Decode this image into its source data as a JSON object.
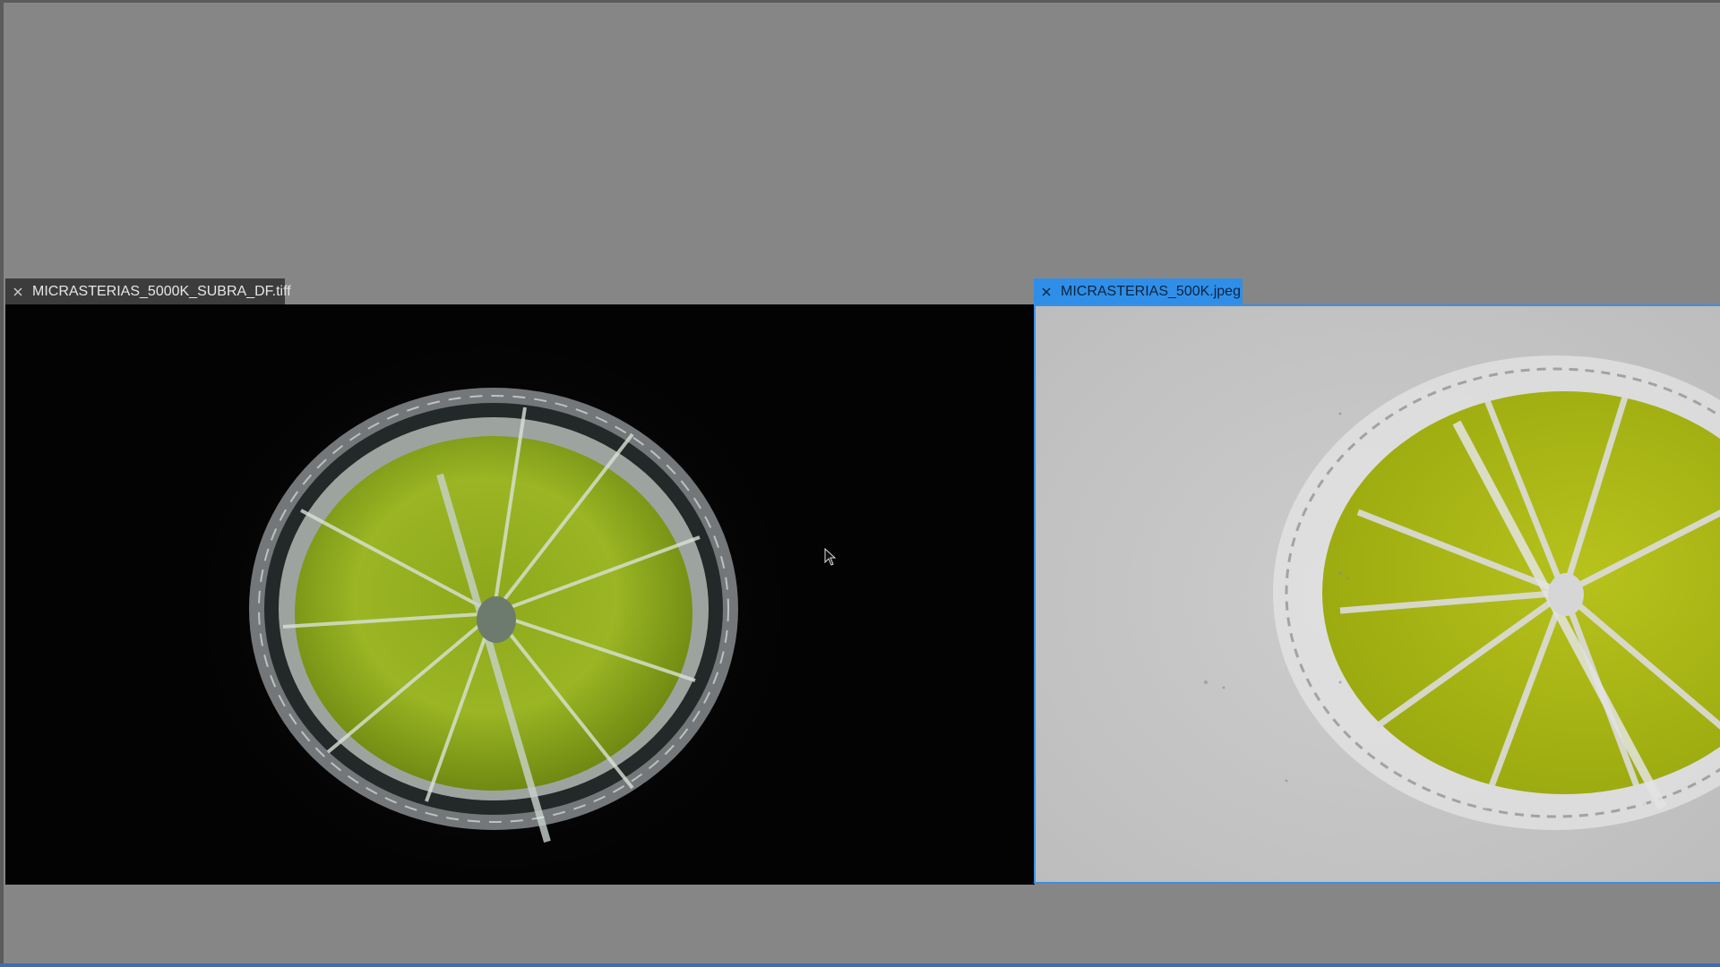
{
  "documents": [
    {
      "id": "left",
      "tab_label": "MICRASTERIAS_5000K_SUBRA_DF.tiff",
      "active": false,
      "image": {
        "description_icon": "darkfield-microscopy-image"
      }
    },
    {
      "id": "right",
      "tab_label": "MICRASTERIAS_500K.jpeg",
      "active": true,
      "image": {
        "description_icon": "brightfield-microscopy-image"
      }
    }
  ],
  "colors": {
    "workspace": "#868686",
    "active_tab": "#2f8fe8",
    "inactive_tab": "#3c3c3c",
    "darkfield_bg": "#030303",
    "brightfield_bg": "#c6c6c6",
    "chloroplast": "#9fb71e",
    "accent_blue": "#3b6fb3"
  }
}
